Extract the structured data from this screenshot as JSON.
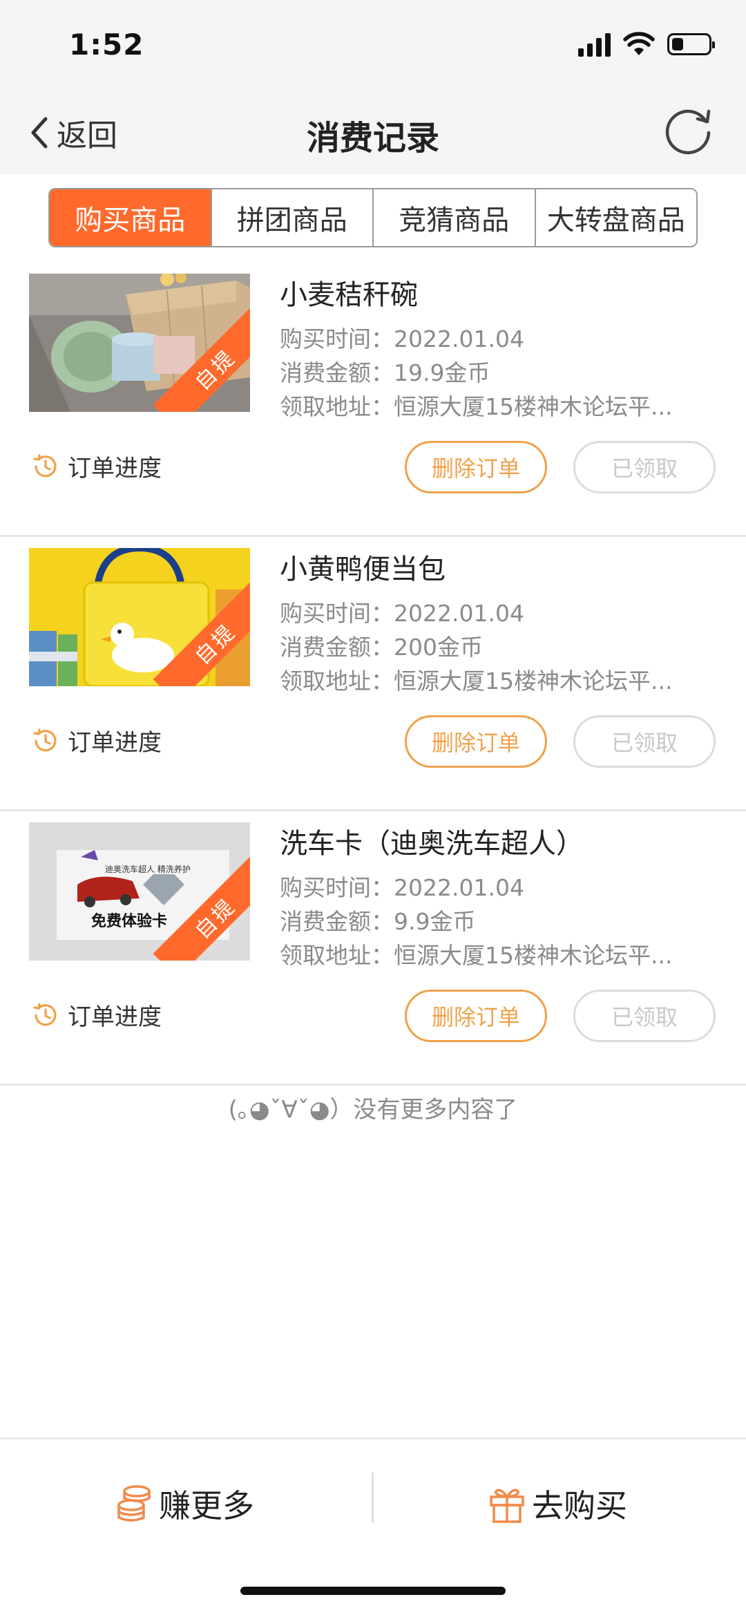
{
  "status_bar": {
    "time": "1:52",
    "battery_level": 0.3
  },
  "nav": {
    "back_label": "返回",
    "title": "消费记录"
  },
  "tabs": [
    {
      "label": "购买商品",
      "active": true
    },
    {
      "label": "拼团商品",
      "active": false
    },
    {
      "label": "竞猜商品",
      "active": false
    },
    {
      "label": "大转盘商品",
      "active": false
    }
  ],
  "orders": [
    {
      "title": "小麦秸秆碗",
      "time": "购买时间：2022.01.04",
      "amount": "消费金额：19.9金币",
      "address": "领取地址：恒源大厦15楼神木论坛平...",
      "badge": "自提",
      "progress_label": "订单进度",
      "delete_label": "删除订单",
      "claimed_label": "已领取"
    },
    {
      "title": "小黄鸭便当包",
      "time": "购买时间：2022.01.04",
      "amount": "消费金额：200金币",
      "address": "领取地址：恒源大厦15楼神木论坛平...",
      "badge": "自提",
      "progress_label": "订单进度",
      "delete_label": "删除订单",
      "claimed_label": "已领取"
    },
    {
      "title": "洗车卡（迪奥洗车超人）",
      "time": "购买时间：2022.01.04",
      "amount": "消费金额：9.9金币",
      "address": "领取地址：恒源大厦15楼神木论坛平...",
      "badge": "自提",
      "progress_label": "订单进度",
      "delete_label": "删除订单",
      "claimed_label": "已领取",
      "card_text_top": "迪奥洗车超人 精洗养护",
      "card_text_main": "免费体验卡"
    }
  ],
  "end_note": "(｡◕ˇ∀ˇ◕）没有更多内容了",
  "bottom_bar": {
    "earn_label": "赚更多",
    "buy_label": "去购买"
  },
  "colors": {
    "accent": "#ff6a2c",
    "button_orange": "#f0a14a",
    "muted": "#8a8a8a"
  }
}
